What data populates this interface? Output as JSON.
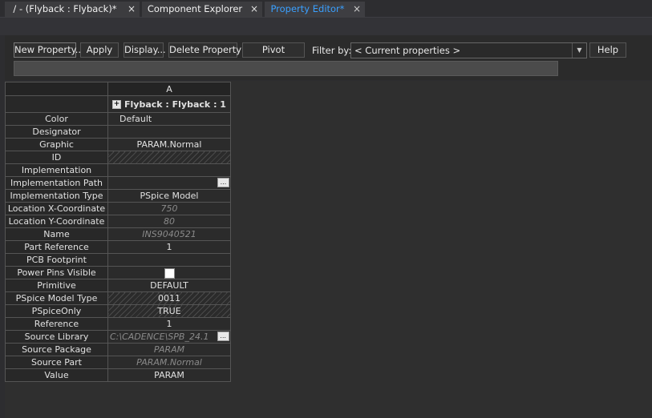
{
  "tabs": [
    {
      "label": "/ - (Flyback : Flyback)*",
      "close": "×",
      "active": false
    },
    {
      "label": "Component Explorer",
      "close": "×",
      "active": false
    },
    {
      "label": "Property Editor*",
      "close": "×",
      "active": true
    }
  ],
  "toolbar": {
    "new_property": "New Property...",
    "apply": "Apply",
    "display": "Display...",
    "delete_property": "Delete Property",
    "pivot": "Pivot",
    "filter_label": "Filter by:",
    "filter_value": "< Current properties >",
    "help": "Help"
  },
  "grid": {
    "column_header": "A",
    "part_title": "Flyback : Flyback : 1",
    "expand_glyph": "+",
    "rows": [
      {
        "name": "Color",
        "value": "Default"
      },
      {
        "name": "Designator",
        "value": ""
      },
      {
        "name": "Graphic",
        "value": "PARAM.Normal"
      },
      {
        "name": "ID",
        "value": ""
      },
      {
        "name": "Implementation",
        "value": ""
      },
      {
        "name": "Implementation Path",
        "value": ""
      },
      {
        "name": "Implementation Type",
        "value": "PSpice Model"
      },
      {
        "name": "Location X-Coordinate",
        "value": "750"
      },
      {
        "name": "Location Y-Coordinate",
        "value": "80"
      },
      {
        "name": "Name",
        "value": "INS9040521"
      },
      {
        "name": "Part Reference",
        "value": "1"
      },
      {
        "name": "PCB Footprint",
        "value": ""
      },
      {
        "name": "Power Pins Visible",
        "value": ""
      },
      {
        "name": "Primitive",
        "value": "DEFAULT"
      },
      {
        "name": "PSpice Model Type",
        "value": "0011"
      },
      {
        "name": "PSpiceOnly",
        "value": "TRUE"
      },
      {
        "name": "Reference",
        "value": "1"
      },
      {
        "name": "Source Library",
        "value": "C:\\CADENCE\\SPB_24.1"
      },
      {
        "name": "Source Package",
        "value": "PARAM"
      },
      {
        "name": "Source Part",
        "value": "PARAM.Normal"
      },
      {
        "name": "Value",
        "value": "PARAM"
      }
    ],
    "ellipsis": "..."
  }
}
